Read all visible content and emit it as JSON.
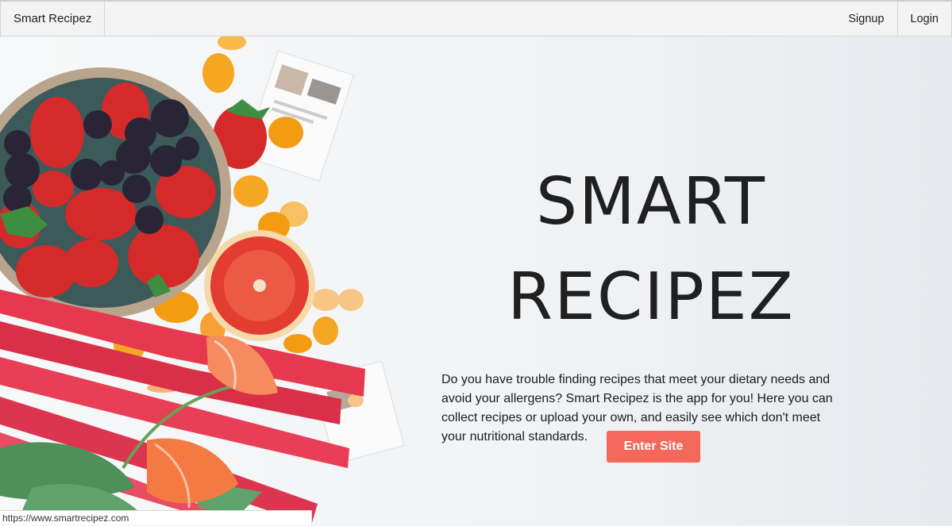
{
  "navbar": {
    "brand": "Smart Recipez",
    "signup_label": "Signup",
    "login_label": "Login"
  },
  "hero": {
    "title_line1": "SMART",
    "title_line2": "RECIPEZ",
    "description": "Do you have trouble finding recipes that meet your dietary needs and avoid your allergens? Smart Recipez is the app for you! Here you can collect recipes or upload your own, and easily see which don't meet your nutritional standards.",
    "enter_label": "Enter Site",
    "accent_color": "#f4675b"
  },
  "status_bar": {
    "url": "https://www.smartrecipez.com"
  }
}
